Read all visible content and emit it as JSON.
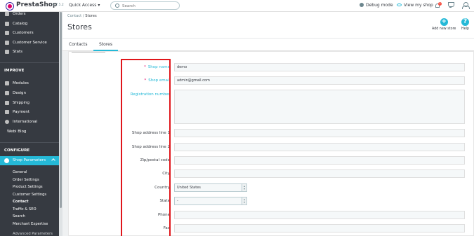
{
  "header": {
    "logo_text": "PrestaShop",
    "version": "1.7.5.2",
    "quick_access": "Quick Access",
    "search_placeholder": "Search",
    "debug_mode": "Debug mode",
    "view_my_shop": "View my shop",
    "notification_count": "1"
  },
  "sidebar": {
    "items_top": [
      {
        "label": "Orders",
        "icon": "orders-icon"
      },
      {
        "label": "Catalog",
        "icon": "catalog-icon"
      },
      {
        "label": "Customers",
        "icon": "customers-icon"
      },
      {
        "label": "Customer Service",
        "icon": "customer-service-icon"
      },
      {
        "label": "Stats",
        "icon": "stats-icon"
      }
    ],
    "section_improve": "IMPROVE",
    "items_improve": [
      {
        "label": "Modules",
        "icon": "modules-icon"
      },
      {
        "label": "Design",
        "icon": "design-icon"
      },
      {
        "label": "Shipping",
        "icon": "shipping-icon"
      },
      {
        "label": "Payment",
        "icon": "payment-icon"
      },
      {
        "label": "International",
        "icon": "globe-icon"
      }
    ],
    "webi_blog": "Webi Blog",
    "section_configure": "CONFIGURE",
    "active_item": "Shop Parameters",
    "sub_items": [
      "General",
      "Order Settings",
      "Product Settings",
      "Customer Settings",
      "Contact",
      "Traffic & SEO",
      "Search",
      "Merchant Expertise"
    ],
    "current_sub": "Contact",
    "next_item": "Advanced Parameters"
  },
  "page": {
    "breadcrumb_parent": "Contact",
    "breadcrumb_sep": "/",
    "breadcrumb_current": "Stores",
    "title": "Stores",
    "add_new_store": "Add new store",
    "help": "Help"
  },
  "tabs": [
    {
      "label": "Contacts"
    },
    {
      "label": "Stores"
    }
  ],
  "form": {
    "shop_name_label": "Shop name",
    "shop_name_value": "demo",
    "shop_email_label": "Shop email",
    "shop_email_value": "admin@gmail.com",
    "registration_number_label": "Registration number",
    "address1_label": "Shop address line 1",
    "address2_label": "Shop address line 2",
    "zip_label": "Zip/postal code",
    "city_label": "City",
    "country_label": "Country",
    "country_value": "United States",
    "state_label": "State",
    "state_value": "-",
    "phone_label": "Phone",
    "fax_label": "Fax",
    "required_marker": "*"
  },
  "colors": {
    "accent": "#25b9d7",
    "sidebar_bg": "#363a41",
    "highlight": "#e0161b",
    "required": "#df0067"
  }
}
